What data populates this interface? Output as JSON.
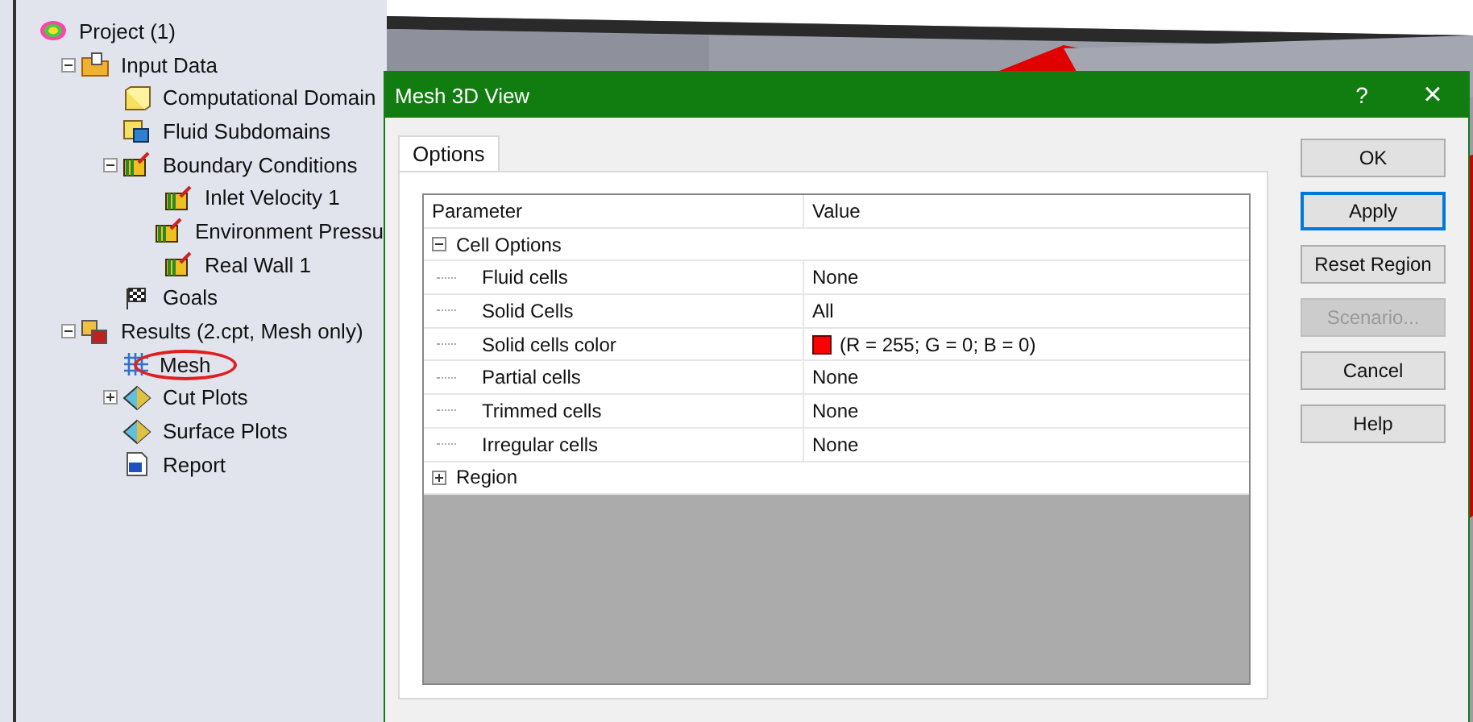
{
  "tree": [
    {
      "label": "Project (1)",
      "kind": "project",
      "circled": false,
      "children": [
        {
          "label": "Input Data",
          "kind": "folder",
          "expanded": true,
          "circled": false,
          "children": [
            {
              "label": "Computational Domain",
              "kind": "domain",
              "circled": false
            },
            {
              "label": "Fluid Subdomains",
              "kind": "subdomain",
              "circled": false
            },
            {
              "label": "Boundary Conditions",
              "kind": "boundary",
              "expanded": true,
              "circled": false,
              "children": [
                {
                  "label": "Inlet Velocity 1",
                  "kind": "boundary",
                  "circled": false
                },
                {
                  "label": "Environment Pressu",
                  "kind": "boundary",
                  "circled": false
                },
                {
                  "label": "Real Wall 1",
                  "kind": "boundary",
                  "circled": false
                }
              ]
            },
            {
              "label": "Goals",
              "kind": "goals",
              "circled": false
            }
          ]
        },
        {
          "label": "Results (2.cpt, Mesh only)",
          "kind": "results",
          "expanded": true,
          "circled": false,
          "children": [
            {
              "label": "Mesh",
              "kind": "mesh",
              "circled": true
            },
            {
              "label": "Cut Plots",
              "kind": "plot",
              "expanded": false,
              "circled": false
            },
            {
              "label": "Surface Plots",
              "kind": "plot",
              "circled": false
            },
            {
              "label": "Report",
              "kind": "report",
              "circled": false
            }
          ]
        }
      ]
    }
  ],
  "dialog": {
    "title": "Mesh 3D View",
    "help": "?",
    "close": "×",
    "tabs": [
      {
        "label": "Options",
        "selected": true
      }
    ],
    "grid": {
      "columns": [
        "Parameter",
        "Value"
      ],
      "rows": [
        {
          "kind": "group",
          "label": "Cell Options",
          "expanded": true,
          "children": [
            {
              "kind": "property",
              "label": "Fluid cells",
              "value": "None"
            },
            {
              "kind": "property",
              "label": "Solid Cells",
              "value": "All"
            },
            {
              "kind": "property",
              "label": "Solid cells color",
              "value": "(R = 255; G = 0; B = 0)",
              "color": "#ff0000"
            },
            {
              "kind": "property",
              "label": "Partial cells",
              "value": "None"
            },
            {
              "kind": "property",
              "label": "Trimmed cells",
              "value": "None"
            },
            {
              "kind": "property",
              "label": "Irregular cells",
              "value": "None"
            }
          ]
        },
        {
          "kind": "group",
          "label": "Region",
          "expanded": false
        }
      ]
    },
    "buttons": [
      {
        "label": "OK",
        "focused": false,
        "disabled": false
      },
      {
        "label": "Apply",
        "focused": true,
        "disabled": false
      },
      {
        "label": "Reset Region",
        "focused": false,
        "disabled": false
      },
      {
        "label": "Scenario...",
        "focused": false,
        "disabled": true
      },
      {
        "label": "Cancel",
        "focused": false,
        "disabled": false
      },
      {
        "label": "Help",
        "focused": false,
        "disabled": false
      }
    ]
  }
}
